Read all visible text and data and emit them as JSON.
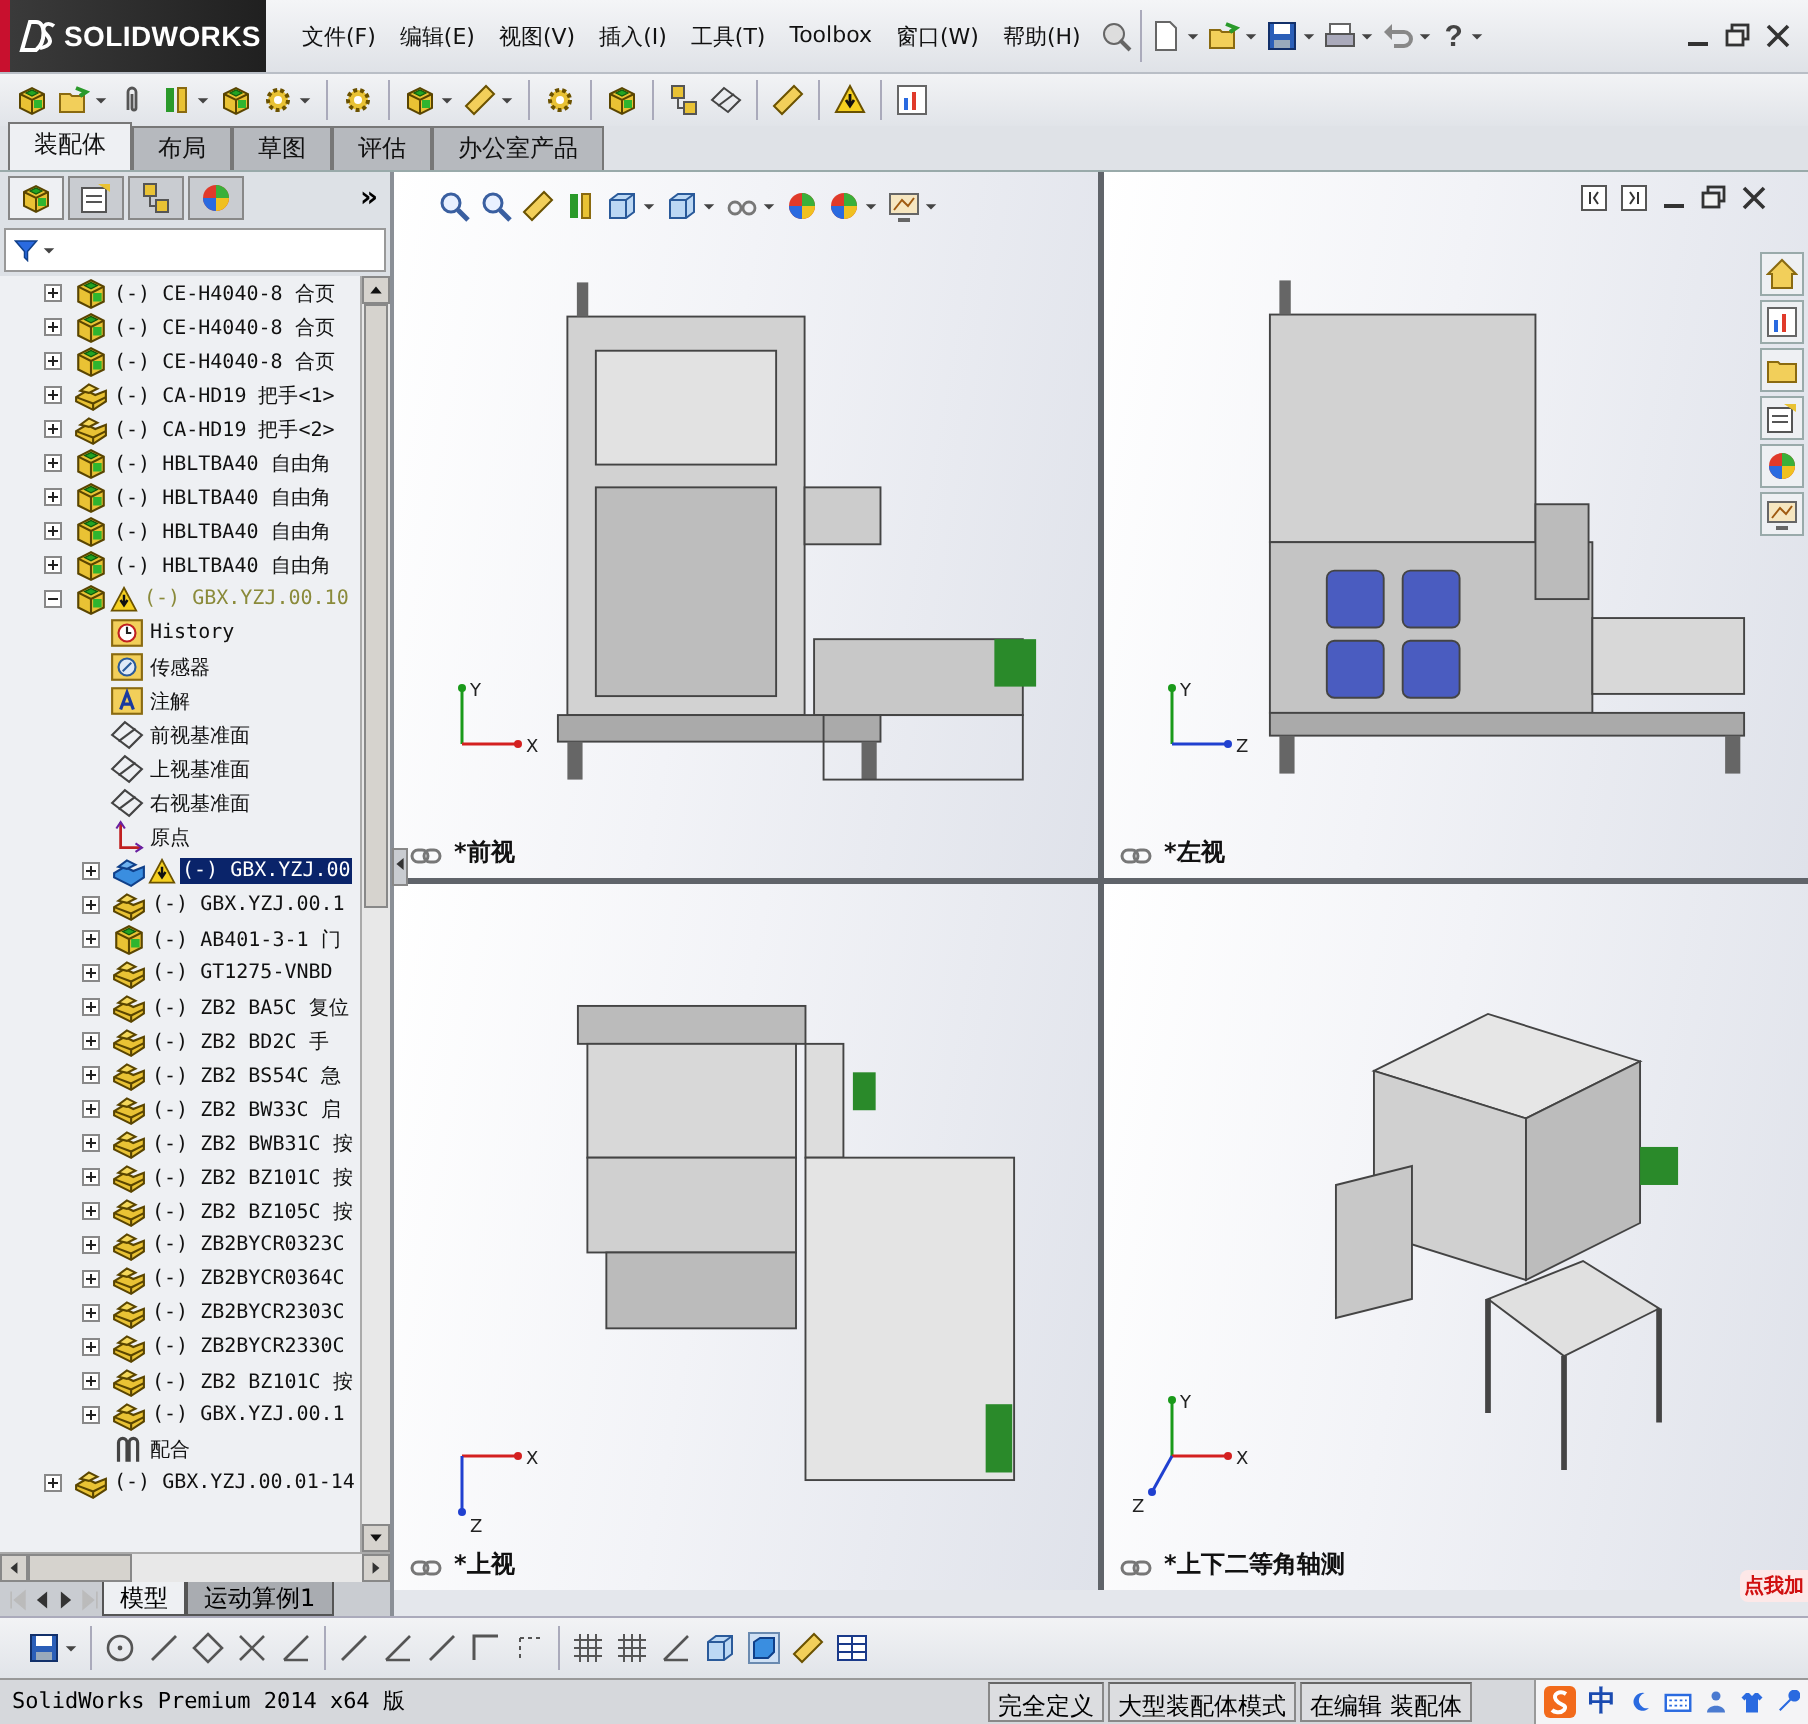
{
  "app": {
    "logo": "SOLIDWORKS"
  },
  "menu": [
    "文件(F)",
    "编辑(E)",
    "视图(V)",
    "插入(I)",
    "工具(T)",
    "Toolbox",
    "窗口(W)",
    "帮助(H)"
  ],
  "help_glyph": "?",
  "tabs": [
    {
      "label": "装配体",
      "selected": true
    },
    {
      "label": "布局",
      "selected": false
    },
    {
      "label": "草图",
      "selected": false
    },
    {
      "label": "评估",
      "selected": false
    },
    {
      "label": "办公室产品",
      "selected": false
    }
  ],
  "feature_manager": {
    "more": "»",
    "tree": [
      {
        "label": "(-) CE-H4040-8 合页",
        "kind": "assembly",
        "expanded": false,
        "selected": false,
        "warning": false
      },
      {
        "label": "(-) CE-H4040-8 合页",
        "kind": "assembly",
        "expanded": false,
        "selected": false,
        "warning": false
      },
      {
        "label": "(-) CE-H4040-8 合页",
        "kind": "assembly",
        "expanded": false,
        "selected": false,
        "warning": false
      },
      {
        "label": "(-) CA-HD19 把手<1>",
        "kind": "part",
        "expanded": false,
        "selected": false,
        "warning": false
      },
      {
        "label": "(-) CA-HD19 把手<2>",
        "kind": "part",
        "expanded": false,
        "selected": false,
        "warning": false
      },
      {
        "label": "(-) HBLTBA40 自由角",
        "kind": "assembly",
        "expanded": false,
        "selected": false,
        "warning": false
      },
      {
        "label": "(-) HBLTBA40 自由角",
        "kind": "assembly",
        "expanded": false,
        "selected": false,
        "warning": false
      },
      {
        "label": "(-) HBLTBA40 自由角",
        "kind": "assembly",
        "expanded": false,
        "selected": false,
        "warning": false
      },
      {
        "label": "(-) HBLTBA40 自由角",
        "kind": "assembly",
        "expanded": false,
        "selected": false,
        "warning": false
      },
      {
        "label": "(-) GBX.YZJ.00.10",
        "kind": "assembly",
        "expanded": true,
        "selected": false,
        "warning": true,
        "children": [
          {
            "label": "History",
            "kind": "history",
            "selected": false,
            "warning": false
          },
          {
            "label": "传感器",
            "kind": "sensor",
            "selected": false,
            "warning": false
          },
          {
            "label": "注解",
            "kind": "annotation",
            "selected": false,
            "warning": false
          },
          {
            "label": "前视基准面",
            "kind": "plane",
            "selected": false,
            "warning": false
          },
          {
            "label": "上视基准面",
            "kind": "plane",
            "selected": false,
            "warning": false
          },
          {
            "label": "右视基准面",
            "kind": "plane",
            "selected": false,
            "warning": false
          },
          {
            "label": "原点",
            "kind": "origin",
            "selected": false,
            "warning": false
          },
          {
            "label": "(-) GBX.YZJ.00",
            "kind": "part",
            "expanded": false,
            "selected": true,
            "warning": true
          },
          {
            "label": "(-) GBX.YZJ.00.1",
            "kind": "part",
            "expanded": false,
            "selected": false,
            "warning": false
          },
          {
            "label": "(-) AB401-3-1 门",
            "kind": "assembly",
            "expanded": false,
            "selected": false,
            "warning": false
          },
          {
            "label": "(-) GT1275-VNBD",
            "kind": "part",
            "expanded": false,
            "selected": false,
            "warning": false
          },
          {
            "label": "(-) ZB2 BA5C 复位",
            "kind": "part",
            "expanded": false,
            "selected": false,
            "warning": false
          },
          {
            "label": "(-) ZB2 BD2C 手",
            "kind": "part",
            "expanded": false,
            "selected": false,
            "warning": false
          },
          {
            "label": "(-) ZB2 BS54C 急",
            "kind": "part",
            "expanded": false,
            "selected": false,
            "warning": false
          },
          {
            "label": "(-) ZB2 BW33C 启",
            "kind": "part",
            "expanded": false,
            "selected": false,
            "warning": false
          },
          {
            "label": "(-) ZB2 BWB31C 按",
            "kind": "part",
            "expanded": false,
            "selected": false,
            "warning": false
          },
          {
            "label": "(-) ZB2 BZ101C 按",
            "kind": "part",
            "expanded": false,
            "selected": false,
            "warning": false
          },
          {
            "label": "(-) ZB2 BZ105C 按",
            "kind": "part",
            "expanded": false,
            "selected": false,
            "warning": false
          },
          {
            "label": "(-) ZB2BYCR0323C",
            "kind": "part",
            "expanded": false,
            "selected": false,
            "warning": false
          },
          {
            "label": "(-) ZB2BYCR0364C",
            "kind": "part",
            "expanded": false,
            "selected": false,
            "warning": false
          },
          {
            "label": "(-) ZB2BYCR2303C",
            "kind": "part",
            "expanded": false,
            "selected": false,
            "warning": false
          },
          {
            "label": "(-) ZB2BYCR2330C",
            "kind": "part",
            "expanded": false,
            "selected": false,
            "warning": false
          },
          {
            "label": "(-) ZB2 BZ101C 按",
            "kind": "part",
            "expanded": false,
            "selected": false,
            "warning": false
          },
          {
            "label": "(-) GBX.YZJ.00.1",
            "kind": "part",
            "expanded": false,
            "selected": false,
            "warning": false
          },
          {
            "label": "配合",
            "kind": "mates",
            "selected": false,
            "warning": false
          }
        ]
      },
      {
        "label": "(-) GBX.YZJ.00.01-14",
        "kind": "part",
        "expanded": false,
        "selected": false,
        "warning": false
      }
    ],
    "bottom_tabs": [
      {
        "label": "模型",
        "selected": true
      },
      {
        "label": "运动算例1",
        "selected": false
      }
    ]
  },
  "viewports": [
    {
      "kind": "front",
      "label": "*前视",
      "axes": [
        {
          "label": "Y",
          "color": "#1a9a1a"
        },
        {
          "label": "X",
          "color": "#d42020"
        }
      ]
    },
    {
      "kind": "left",
      "label": "*左视",
      "axes": [
        {
          "label": "Y",
          "color": "#1a9a1a"
        },
        {
          "label": "Z",
          "color": "#2040d0"
        }
      ]
    },
    {
      "kind": "top",
      "label": "*上视",
      "axes": [
        {
          "label": "X",
          "color": "#d42020"
        },
        {
          "label": "Z",
          "color": "#2040d0"
        }
      ]
    },
    {
      "kind": "iso",
      "label": "*上下二等角轴测",
      "axes": [
        {
          "label": "Y",
          "color": "#1a9a1a"
        },
        {
          "label": "X",
          "color": "#d42020"
        },
        {
          "label": "Z",
          "color": "#2040d0"
        }
      ]
    }
  ],
  "promo_badge": "点我加",
  "status_bar": {
    "app_version": "SolidWorks Premium 2014 x64 版",
    "fields": [
      "完全定义",
      "大型装配体模式",
      "在编辑 装配体"
    ],
    "ime": "中"
  }
}
